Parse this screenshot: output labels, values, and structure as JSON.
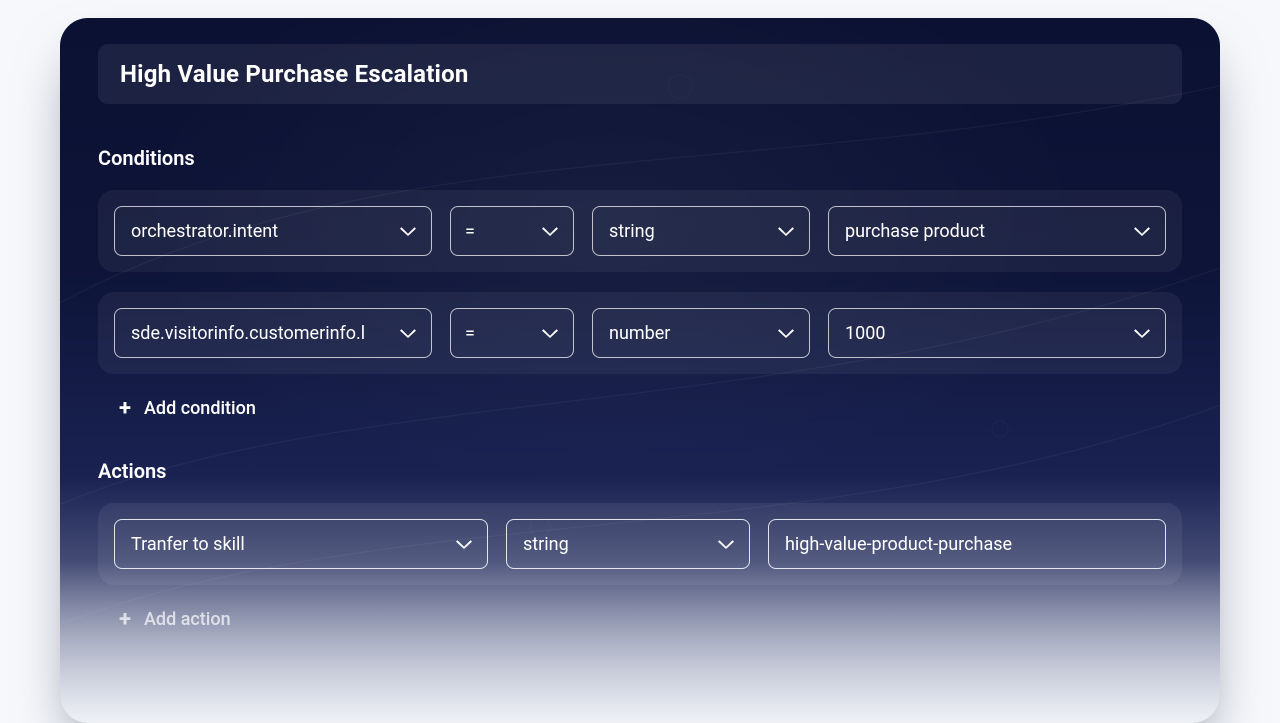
{
  "title": "High Value Purchase Escalation",
  "sections": {
    "conditions_label": "Conditions",
    "actions_label": "Actions",
    "add_condition_label": "Add condition",
    "add_action_label": "Add action"
  },
  "conditions": [
    {
      "attribute": "orchestrator.intent",
      "operator": "=",
      "type": "string",
      "value": "purchase product"
    },
    {
      "attribute": "sde.visitorinfo.customerinfo.l",
      "operator": "=",
      "type": "number",
      "value": "1000"
    }
  ],
  "actions": [
    {
      "action": "Tranfer to skill",
      "type": "string",
      "value": "high-value-product-purchase"
    }
  ]
}
